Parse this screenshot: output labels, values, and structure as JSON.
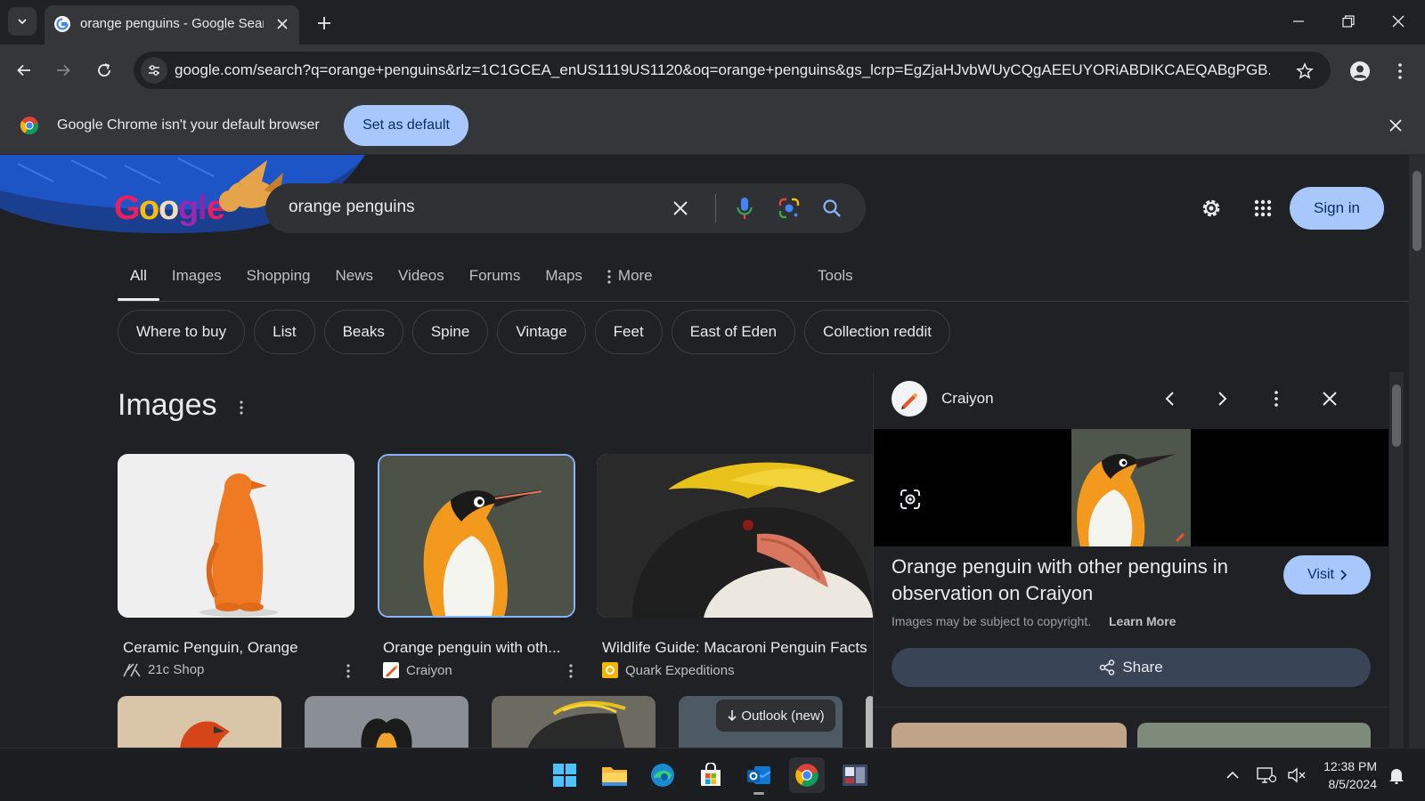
{
  "browser": {
    "tab_title": "orange penguins - Google Search",
    "url": "google.com/search?q=orange+penguins&rlz=1C1GCEA_enUS1119US1120&oq=orange+penguins&gs_lcrp=EgZjaHJvbWUyCQgAEEUYORiABDIKCAEQABgPGB...",
    "infobar_text": "Google Chrome isn't your default browser",
    "set_default_label": "Set as default"
  },
  "search": {
    "query": "orange penguins",
    "sign_in_label": "Sign in"
  },
  "nav_tabs": [
    {
      "label": "All",
      "active": true
    },
    {
      "label": "Images"
    },
    {
      "label": "Shopping"
    },
    {
      "label": "News"
    },
    {
      "label": "Videos"
    },
    {
      "label": "Forums"
    },
    {
      "label": "Maps"
    },
    {
      "label": "More"
    }
  ],
  "tools_label": "Tools",
  "chips": [
    "Where to buy",
    "List",
    "Beaks",
    "Spine",
    "Vintage",
    "Feet",
    "East of Eden",
    "Collection reddit"
  ],
  "images_heading": "Images",
  "image_results": [
    {
      "title": "Ceramic Penguin, Orange",
      "source": "21c Shop"
    },
    {
      "title": "Orange penguin with oth...",
      "source": "Craiyon"
    },
    {
      "title": "Wildlife Guide: Macaroni Penguin Facts",
      "source": "Quark Expeditions"
    }
  ],
  "outlook_toast": "Outlook (new)",
  "side_panel": {
    "source": "Craiyon",
    "title": "Orange penguin with other penguins in observation on Craiyon",
    "visit_label": "Visit",
    "copyright_text": "Images may be subject to copyright.",
    "learn_more_label": "Learn More",
    "share_label": "Share"
  },
  "taskbar": {
    "time": "12:38 PM",
    "date": "8/5/2024"
  },
  "colors": {
    "accent_button": "#a8c7fa",
    "page_bg": "#202124",
    "toolbar_bg": "#35363a"
  }
}
